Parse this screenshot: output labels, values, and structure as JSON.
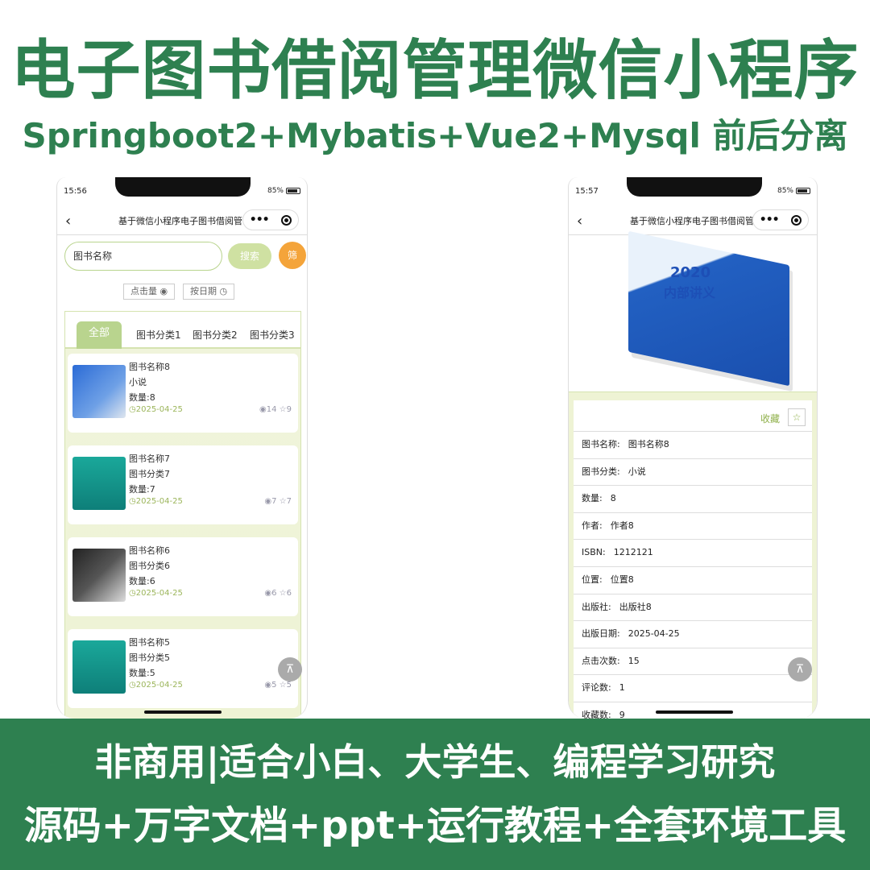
{
  "header": {
    "title": "电子图书借阅管理微信小程序",
    "subtitle": "Springboot2+Mybatis+Vue2+Mysql 前后分离"
  },
  "left_phone": {
    "status": {
      "time": "15:56",
      "battery": "85%"
    },
    "nav_title": "基于微信小程序电子图书借阅管...",
    "search": {
      "placeholder": "图书名称",
      "button": "搜索",
      "filter": "筛"
    },
    "sort": {
      "views": "点击量",
      "date": "按日期"
    },
    "tabs": [
      "全部",
      "图书分类1",
      "图书分类2",
      "图书分类3"
    ],
    "books": [
      {
        "name": "图书名称8",
        "category": "小说",
        "quantity": "数量:8",
        "date": "2025-04-25",
        "views": "14",
        "favorites": "9",
        "cover": "blue"
      },
      {
        "name": "图书名称7",
        "category": "图书分类7",
        "quantity": "数量:7",
        "date": "2025-04-25",
        "views": "7",
        "favorites": "7",
        "cover": "teal"
      },
      {
        "name": "图书名称6",
        "category": "图书分类6",
        "quantity": "数量:6",
        "date": "2025-04-25",
        "views": "6",
        "favorites": "6",
        "cover": "dark"
      },
      {
        "name": "图书名称5",
        "category": "图书分类5",
        "quantity": "数量:5",
        "date": "2025-04-25",
        "views": "5",
        "favorites": "5",
        "cover": "teal"
      }
    ]
  },
  "right_phone": {
    "status": {
      "time": "15:57",
      "battery": "85%"
    },
    "nav_title": "基于微信小程序电子图书借阅管...",
    "cover": {
      "year": "2020",
      "name": "内部讲义"
    },
    "favorite_label": "收藏",
    "details": [
      {
        "label": "图书名称:",
        "value": "图书名称8"
      },
      {
        "label": "图书分类:",
        "value": "小说"
      },
      {
        "label": "数量:",
        "value": "8"
      },
      {
        "label": "作者:",
        "value": "作者8"
      },
      {
        "label": "ISBN:",
        "value": "1212121"
      },
      {
        "label": "位置:",
        "value": "位置8"
      },
      {
        "label": "出版社:",
        "value": "出版社8"
      },
      {
        "label": "出版日期:",
        "value": "2025-04-25"
      },
      {
        "label": "点击次数:",
        "value": "15"
      },
      {
        "label": "评论数:",
        "value": "1"
      },
      {
        "label": "收藏数:",
        "value": "9"
      }
    ]
  },
  "footer": {
    "line1": "非商用|适合小白、大学生、编程学习研究",
    "line2": "源码+万字文档+ppt+运行教程+全套环境工具"
  },
  "colors": {
    "brand_green": "#2e8050",
    "light_green": "#b9d48e",
    "orange": "#f4a43a"
  }
}
